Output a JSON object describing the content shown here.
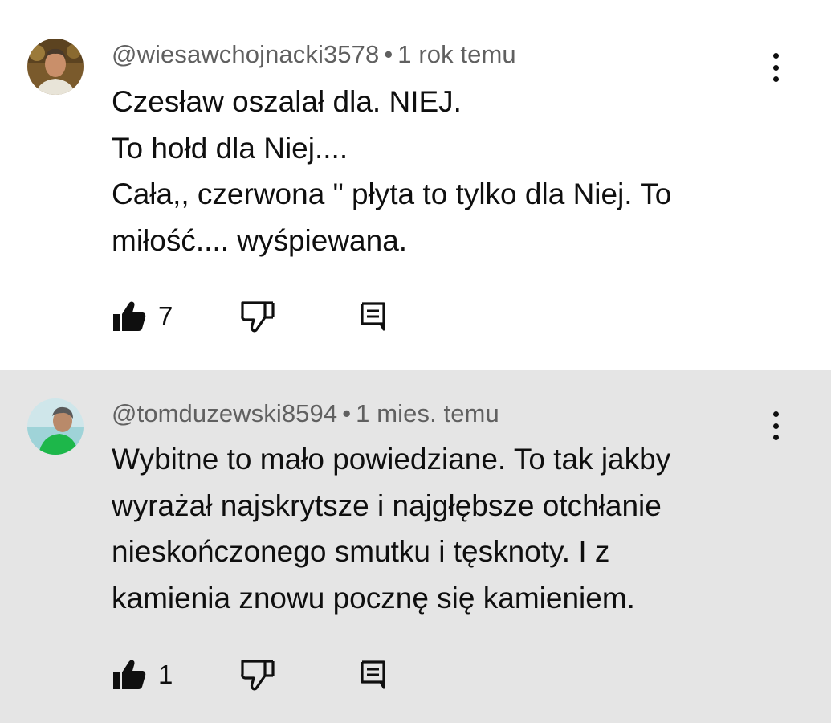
{
  "comments": [
    {
      "author": "@wiesawchojnacki3578",
      "separator": "•",
      "time": "1 rok temu",
      "lines": [
        "Czesław oszalał dla. NIEJ.",
        "To hołd dla Niej....",
        "Cała,, czerwona \" płyta to tylko dla Niej. To",
        "miłość.... wyśpiewana."
      ],
      "likes": "7",
      "highlighted": false
    },
    {
      "author": "@tomduzewski8594",
      "separator": "•",
      "time": "1 mies. temu",
      "lines": [
        "Wybitne to mało powiedziane. To tak jakby",
        "wyrażał najskrytsze i najgłębsze otchłanie",
        "nieskończonego smutku i tęsknoty. I z",
        "kamienia znowu pocznę się kamieniem."
      ],
      "likes": "1",
      "highlighted": true
    }
  ],
  "icons": {
    "like": "thumbs-up-icon",
    "dislike": "thumbs-down-icon",
    "reply": "reply-comment-icon",
    "more": "more-vert-icon"
  },
  "colors": {
    "highlight_background": "#e5e5e5",
    "meta_text": "#606060",
    "body_text": "#0f0f0f"
  }
}
